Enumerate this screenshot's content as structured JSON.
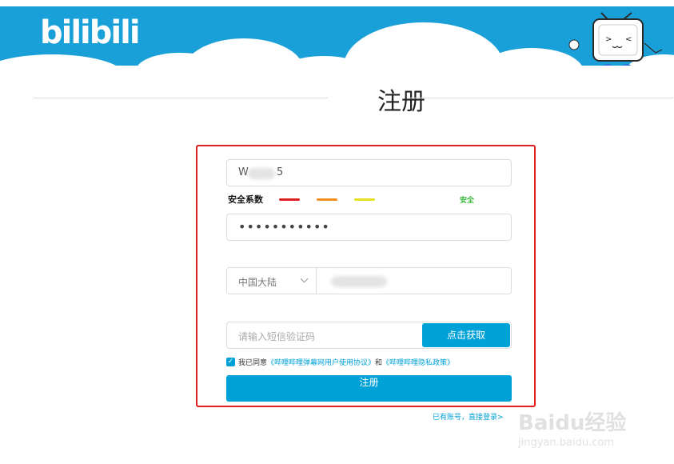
{
  "header": {
    "logo": "bilibili",
    "color": "#1aa0d8"
  },
  "page": {
    "title": "注册"
  },
  "form": {
    "username_visible": "W",
    "username_tail": "5",
    "strength_label": "安全系数",
    "strength_bars": [
      "#e02020",
      "#f0901e",
      "#e6e020"
    ],
    "strength_text": "安全",
    "password_mask": "•••••••••••",
    "country": "中国大陆",
    "sms_placeholder": "请输入短信验证码",
    "sms_button": "点击获取",
    "agree_prefix": "我已同意",
    "agree_link1": "《哔哩哔哩弹幕网用户使用协议》",
    "agree_and": "和",
    "agree_link2": "《哔哩哔哩隐私政策》",
    "submit": "注册"
  },
  "footer": {
    "login": "已有账号，直接登录>"
  },
  "watermark": {
    "brand": "Baidu经验",
    "url": "jingyan.baidu.com"
  }
}
